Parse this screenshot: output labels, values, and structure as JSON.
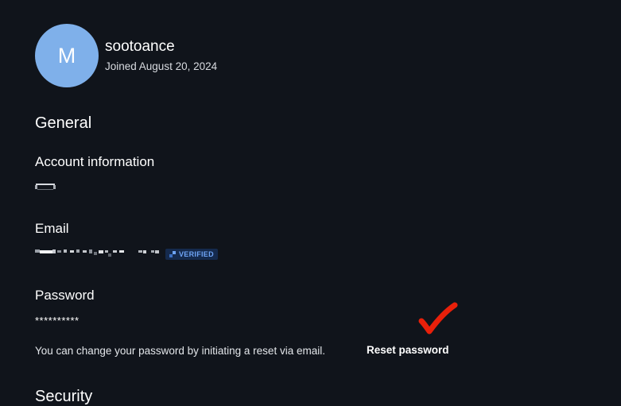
{
  "profile": {
    "avatar_initial": "M",
    "avatar_color": "#7fb0ea",
    "username": "sootoance",
    "joined": "Joined August 20, 2024"
  },
  "general": {
    "title": "General",
    "account": {
      "label": "Account information"
    },
    "email": {
      "label": "Email",
      "badge": "VERIFIED",
      "badge_color": "#6fa5f7"
    },
    "password": {
      "label": "Password",
      "mask": "**********",
      "hint": "You can change your password by initiating a reset via email.",
      "reset_label": "Reset password"
    }
  },
  "next_section": {
    "title": "Security"
  },
  "annotation": {
    "icon": "red-checkmark-icon",
    "color": "#e8200a"
  }
}
